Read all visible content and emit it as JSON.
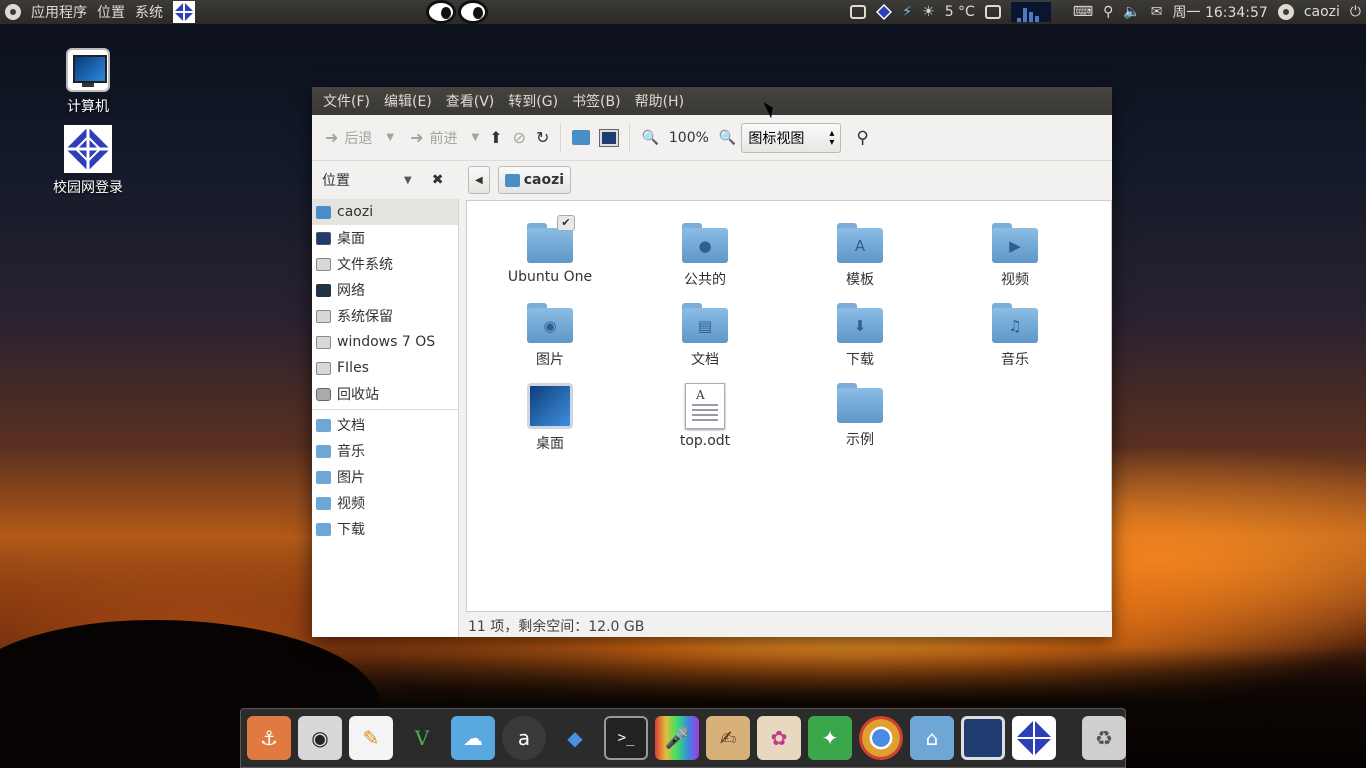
{
  "panel": {
    "menus": [
      "应用程序",
      "位置",
      "系统"
    ],
    "weather": "5 °C",
    "clock": "周一 16:34:57",
    "user": "caozi"
  },
  "desktop_icons": [
    {
      "label": "计算机",
      "icon": "computer-icon"
    },
    {
      "label": "校园网登录",
      "icon": "campus-login-icon"
    }
  ],
  "window": {
    "menubar": [
      "文件(F)",
      "编辑(E)",
      "查看(V)",
      "转到(G)",
      "书签(B)",
      "帮助(H)"
    ],
    "toolbar": {
      "back": "后退",
      "forward": "前进",
      "zoom": "100%",
      "view_mode": "图标视图"
    },
    "sidebar": {
      "header": "位置",
      "places": [
        "caozi",
        "桌面",
        "文件系统",
        "网络",
        "系统保留",
        "windows 7 OS",
        "FIles",
        "回收站"
      ],
      "bookmarks": [
        "文档",
        "音乐",
        "图片",
        "视频",
        "下载"
      ]
    },
    "path": {
      "current": "caozi"
    },
    "files": [
      {
        "name": "Ubuntu One",
        "icon": "folder-icon"
      },
      {
        "name": "公共的",
        "icon": "folder-public-icon"
      },
      {
        "name": "模板",
        "icon": "folder-templates-icon"
      },
      {
        "name": "视频",
        "icon": "folder-videos-icon"
      },
      {
        "name": "图片",
        "icon": "folder-pictures-icon"
      },
      {
        "name": "文档",
        "icon": "folder-documents-icon"
      },
      {
        "name": "下载",
        "icon": "folder-downloads-icon"
      },
      {
        "name": "音乐",
        "icon": "folder-music-icon"
      },
      {
        "name": "桌面",
        "icon": "desktop-icon"
      },
      {
        "name": "top.odt",
        "icon": "document-icon"
      },
      {
        "name": "示例",
        "icon": "folder-icon"
      }
    ],
    "status": "11 项，剩余空间：12.0 GB"
  },
  "dock": [
    "anchor",
    "camera",
    "editor",
    "vim",
    "cloud",
    "a",
    "gem",
    "terminal",
    "mic",
    "sketch",
    "paint",
    "compass",
    "chrome",
    "home",
    "monitor",
    "campus",
    "trash"
  ]
}
